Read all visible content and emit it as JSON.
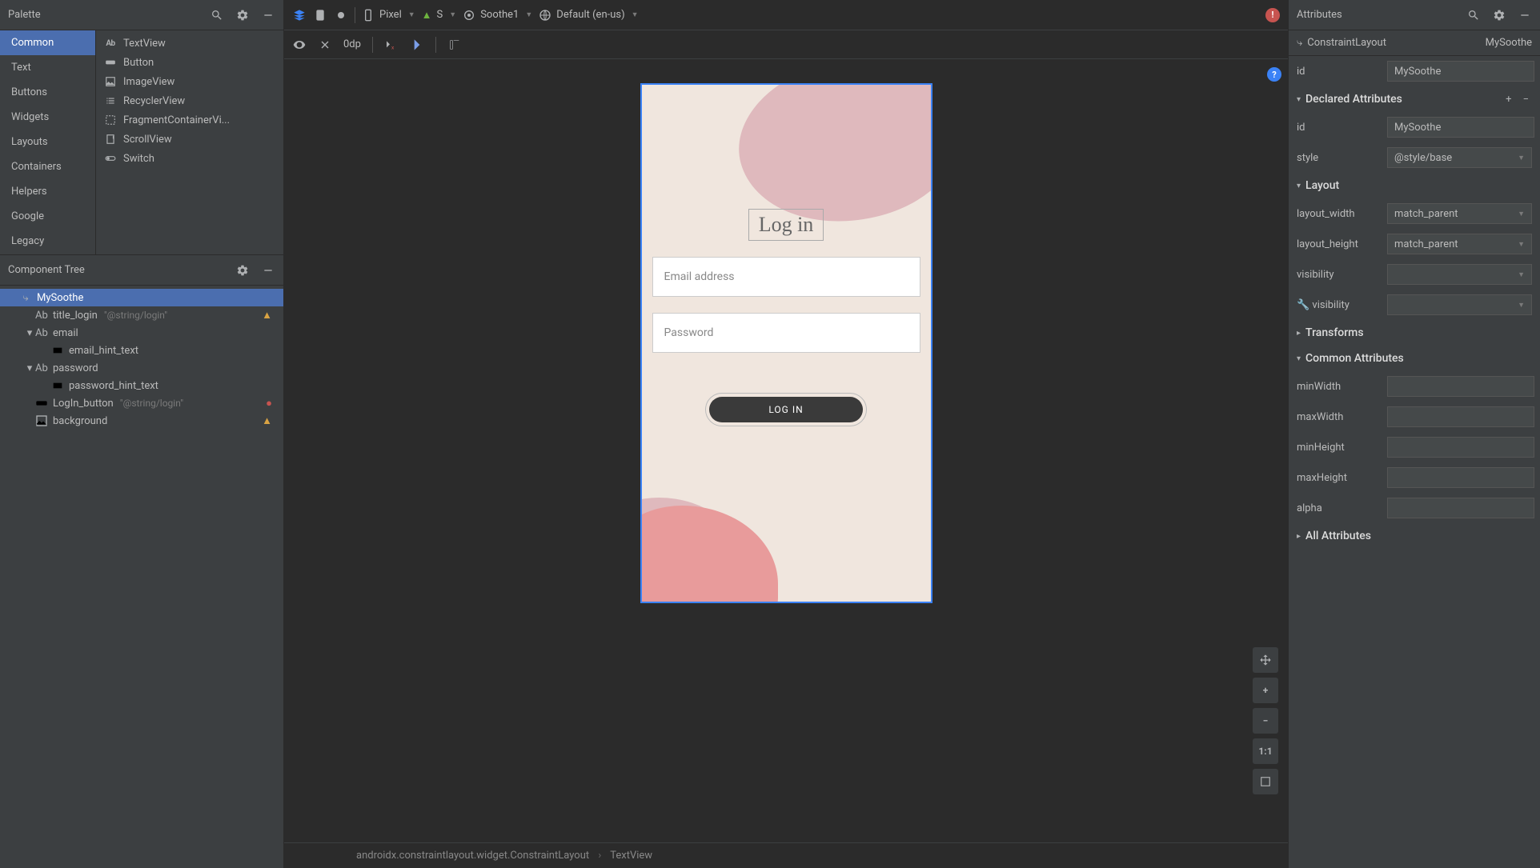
{
  "palette": {
    "title": "Palette",
    "categories": [
      "Common",
      "Text",
      "Buttons",
      "Widgets",
      "Layouts",
      "Containers",
      "Helpers",
      "Google",
      "Legacy"
    ],
    "items": [
      {
        "icon": "ab",
        "label": "TextView"
      },
      {
        "icon": "button",
        "label": "Button"
      },
      {
        "icon": "image",
        "label": "ImageView"
      },
      {
        "icon": "list",
        "label": "RecyclerView"
      },
      {
        "icon": "frag",
        "label": "FragmentContainerVi..."
      },
      {
        "icon": "scroll",
        "label": "ScrollView"
      },
      {
        "icon": "switch",
        "label": "Switch"
      }
    ]
  },
  "componentTree": {
    "title": "Component Tree",
    "items": [
      {
        "indent": 0,
        "chevron": "",
        "icon": "layout",
        "name": "MySoothe",
        "selected": true
      },
      {
        "indent": 1,
        "chevron": "",
        "icon": "ab",
        "name": "title_login",
        "hint": "\"@string/login\"",
        "badge": "warn"
      },
      {
        "indent": 1,
        "chevron": "v",
        "icon": "ab-u",
        "name": "email"
      },
      {
        "indent": 2,
        "chevron": "",
        "icon": "rect",
        "name": "email_hint_text"
      },
      {
        "indent": 1,
        "chevron": "v",
        "icon": "ab-u",
        "name": "password"
      },
      {
        "indent": 2,
        "chevron": "",
        "icon": "rect",
        "name": "password_hint_text"
      },
      {
        "indent": 1,
        "chevron": "",
        "icon": "button",
        "name": "LogIn_button",
        "hint": "\"@string/login\"",
        "badge": "err"
      },
      {
        "indent": 1,
        "chevron": "",
        "icon": "image",
        "name": "background",
        "badge": "warn"
      }
    ]
  },
  "toolbar": {
    "dp": "0dp",
    "device": "Pixel",
    "api": "S",
    "theme": "Soothe1",
    "locale": "Default (en-us)"
  },
  "preview": {
    "title": "Log in",
    "email_hint": "Email address",
    "password_hint": "Password",
    "button": "LOG IN"
  },
  "breadcrumb": {
    "path": "androidx.constraintlayout.widget.ConstraintLayout",
    "leaf": "TextView"
  },
  "attributes": {
    "title": "Attributes",
    "layoutType": "ConstraintLayout",
    "layoutId": "MySoothe",
    "id_label": "id",
    "id_value": "MySoothe",
    "sections": {
      "declared": "Declared Attributes",
      "layout": "Layout",
      "transforms": "Transforms",
      "common": "Common Attributes",
      "all": "All Attributes"
    },
    "declared": [
      {
        "label": "id",
        "value": "MySoothe"
      },
      {
        "label": "style",
        "value": "@style/base",
        "select": true
      }
    ],
    "layout": [
      {
        "label": "layout_width",
        "value": "match_parent",
        "select": true
      },
      {
        "label": "layout_height",
        "value": "match_parent",
        "select": true
      },
      {
        "label": "visibility",
        "value": "",
        "select": true
      },
      {
        "label": "visibility",
        "value": "",
        "select": true,
        "tools": true
      }
    ],
    "common": [
      {
        "label": "minWidth",
        "value": ""
      },
      {
        "label": "maxWidth",
        "value": ""
      },
      {
        "label": "minHeight",
        "value": ""
      },
      {
        "label": "maxHeight",
        "value": ""
      },
      {
        "label": "alpha",
        "value": ""
      }
    ]
  },
  "floatingTools": {
    "ratio": "1:1"
  }
}
